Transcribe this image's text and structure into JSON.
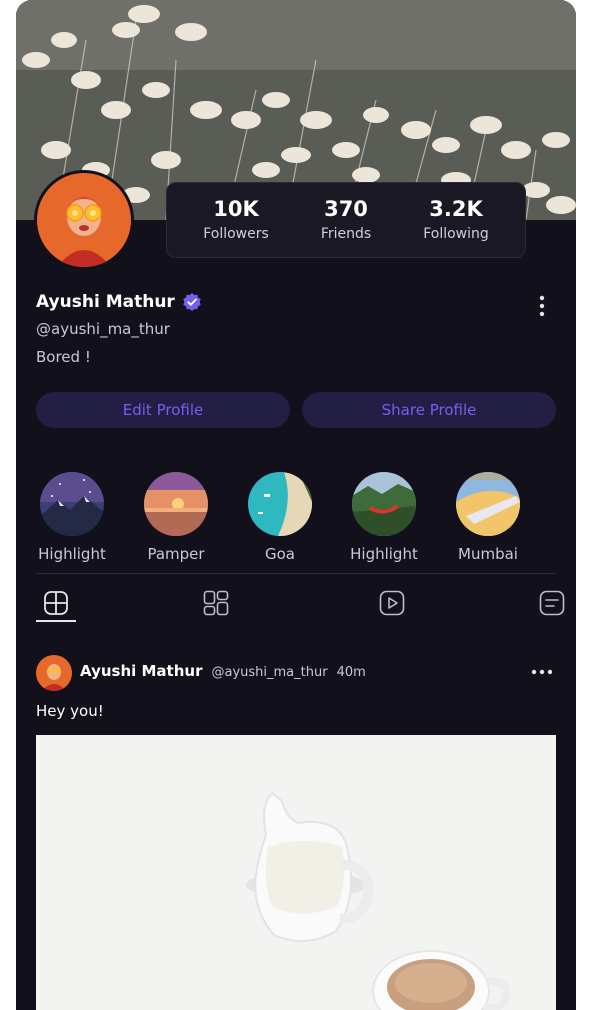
{
  "profile": {
    "name": "Ayushi Mathur",
    "handle": "@ayushi_ma_thur",
    "bio": "Bored !"
  },
  "stats": [
    {
      "value": "10K",
      "label": "Followers"
    },
    {
      "value": "370",
      "label": "Friends"
    },
    {
      "value": "3.2K",
      "label": "Following"
    }
  ],
  "actions": {
    "edit_label": "Edit Profile",
    "share_label": "Share Profile"
  },
  "highlights": [
    {
      "label": "Highlight"
    },
    {
      "label": "Pamper"
    },
    {
      "label": "Goa"
    },
    {
      "label": "Highlight"
    },
    {
      "label": "Mumbai"
    }
  ],
  "tabs": [
    {
      "icon": "grid-icon",
      "active": true
    },
    {
      "icon": "collage-icon",
      "active": false
    },
    {
      "icon": "video-icon",
      "active": false
    },
    {
      "icon": "text-post-icon",
      "active": false
    }
  ],
  "post": {
    "author": "Ayushi Mathur",
    "handle": "@ayushi_ma_thur",
    "time": "40m",
    "text": "Hey you!"
  },
  "colors": {
    "background": "#12101b",
    "accent": "#7c5cf0",
    "button_bg": "#231e44",
    "card_bg": "#1a1825"
  }
}
